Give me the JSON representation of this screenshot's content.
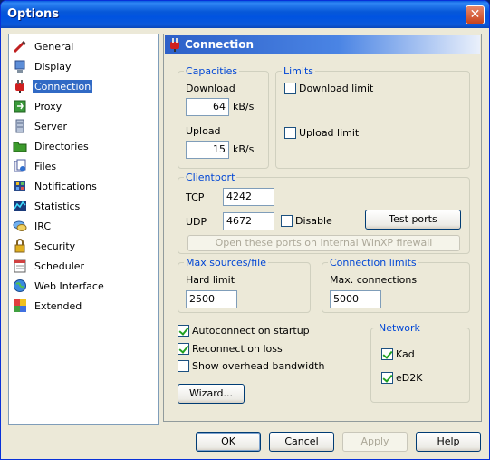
{
  "window": {
    "title": "Options",
    "close_glyph": "✕"
  },
  "sidebar": {
    "items": [
      {
        "label": "General",
        "icon": "pencil-icon"
      },
      {
        "label": "Display",
        "icon": "monitor-icon"
      },
      {
        "label": "Connection",
        "icon": "plug-icon",
        "selected": true
      },
      {
        "label": "Proxy",
        "icon": "proxy-icon"
      },
      {
        "label": "Server",
        "icon": "server-icon"
      },
      {
        "label": "Directories",
        "icon": "folder-icon"
      },
      {
        "label": "Files",
        "icon": "files-icon"
      },
      {
        "label": "Notifications",
        "icon": "notifications-icon"
      },
      {
        "label": "Statistics",
        "icon": "statistics-icon"
      },
      {
        "label": "IRC",
        "icon": "irc-icon"
      },
      {
        "label": "Security",
        "icon": "lock-icon"
      },
      {
        "label": "Scheduler",
        "icon": "scheduler-icon"
      },
      {
        "label": "Web Interface",
        "icon": "globe-icon"
      },
      {
        "label": "Extended",
        "icon": "puzzle-icon"
      }
    ]
  },
  "panel": {
    "title": "Connection"
  },
  "capacities": {
    "legend": "Capacities",
    "download_label": "Download",
    "download_value": "64",
    "upload_label": "Upload",
    "upload_value": "15",
    "unit": "kB/s"
  },
  "limits": {
    "legend": "Limits",
    "download_limit": "Download limit",
    "download_limit_checked": false,
    "upload_limit": "Upload limit",
    "upload_limit_checked": false
  },
  "clientport": {
    "legend": "Clientport",
    "tcp_label": "TCP",
    "tcp_value": "4242",
    "udp_label": "UDP",
    "udp_value": "4672",
    "disable_label": "Disable",
    "disable_checked": false,
    "test_ports": "Test ports",
    "open_ports": "Open these ports on internal WinXP firewall"
  },
  "max_sources": {
    "legend": "Max sources/file",
    "hard_limit_label": "Hard limit",
    "hard_limit_value": "2500"
  },
  "connection_limits": {
    "legend": "Connection limits",
    "max_connections_label": "Max. connections",
    "max_connections_value": "5000"
  },
  "options": {
    "autoconnect": "Autoconnect on startup",
    "autoconnect_checked": true,
    "reconnect": "Reconnect on loss",
    "reconnect_checked": true,
    "overhead": "Show overhead bandwidth",
    "overhead_checked": false,
    "wizard": "Wizard..."
  },
  "network": {
    "legend": "Network",
    "kad": "Kad",
    "kad_checked": true,
    "ed2k": "eD2K",
    "ed2k_checked": true
  },
  "footer": {
    "ok": "OK",
    "cancel": "Cancel",
    "apply": "Apply",
    "help": "Help"
  }
}
